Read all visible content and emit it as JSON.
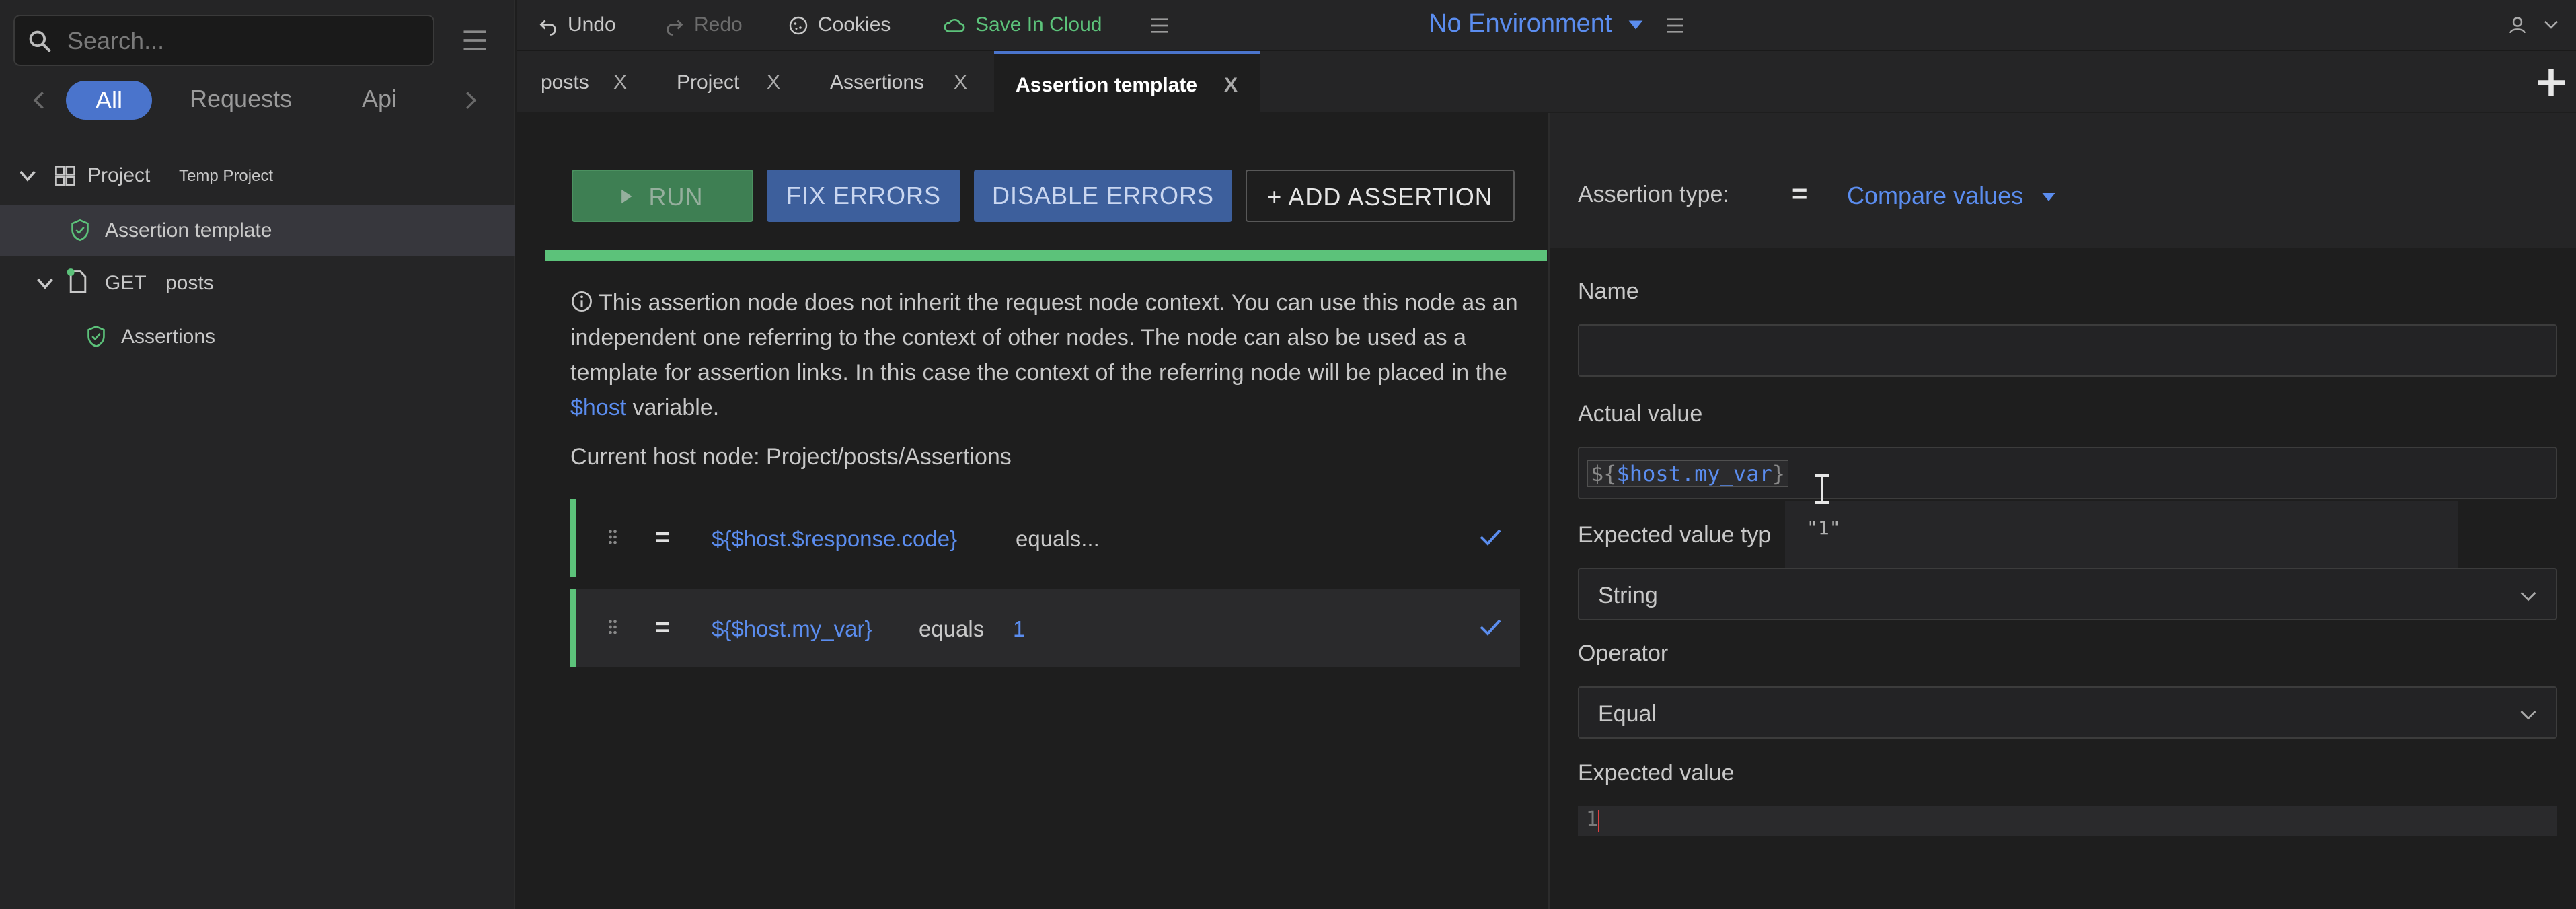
{
  "sidebar": {
    "search_placeholder": "Search...",
    "filters": {
      "all": "All",
      "requests": "Requests",
      "api": "Api"
    },
    "tree": {
      "project_label": "Project",
      "project_sub": "Temp Project",
      "assertion_template_label": "Assertion template",
      "get_method": "GET",
      "get_label": "posts",
      "assertions_label": "Assertions"
    }
  },
  "toolbar": {
    "undo": "Undo",
    "redo": "Redo",
    "cookies": "Cookies",
    "save": "Save In Cloud",
    "environment": "No Environment"
  },
  "tabs": [
    {
      "label": "posts",
      "close": "X"
    },
    {
      "label": "Project",
      "close": "X"
    },
    {
      "label": "Assertions",
      "close": "X"
    },
    {
      "label": "Assertion template",
      "close": "X"
    }
  ],
  "editor": {
    "run_label": "RUN",
    "fix_label": "FIX ERRORS",
    "disable_label": "DISABLE ERRORS",
    "add_label": "+ ADD ASSERTION",
    "info_pre": "This assertion node does not inherit the request node context. You can use this node as an independent one referring to the context of other nodes. The node can also be used as a template for assertion links. In this case the context of the referring node will be placed in the ",
    "info_link": "$host",
    "info_post": " variable.",
    "host_node": "Current host node: Project/posts/Assertions",
    "assertions": [
      {
        "eq": "=",
        "expr": "${$host.$response.code}",
        "op": "equals...",
        "value": ""
      },
      {
        "eq": "=",
        "expr": "${$host.my_var}",
        "op": "equals",
        "value": "1"
      }
    ]
  },
  "panel": {
    "type_label": "Assertion type:",
    "type_eq": "=",
    "type_value": "Compare values",
    "name_label": "Name",
    "name_value": "",
    "actual_label": "Actual value",
    "actual_prefix": "${",
    "actual_var": "$host.my_var",
    "actual_suffix": "}",
    "autocomplete_item": "\"1\"",
    "expected_type_label": "Expected value typ",
    "expected_type_value": "String",
    "operator_label": "Operator",
    "operator_value": "Equal",
    "expected_label": "Expected value",
    "expected_line_number": "1"
  },
  "colors": {
    "accent_blue": "#5b8def",
    "accent_green": "#5cc27a",
    "tab_indicator": "#4a74cc"
  }
}
